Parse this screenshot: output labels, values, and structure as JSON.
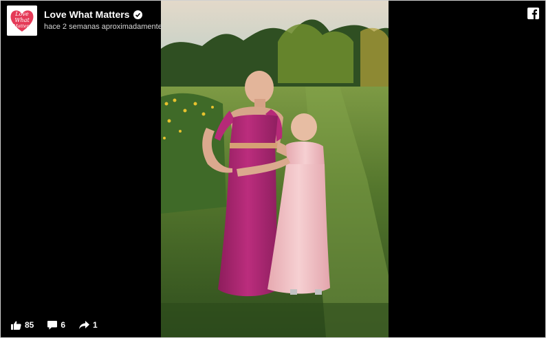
{
  "post": {
    "page_name": "Love What Matters",
    "verified": true,
    "timestamp": "hace 2 semanas aproximadamente"
  },
  "logo": {
    "text_line1": "Love",
    "text_line2": "What",
    "text_line3": "Matters",
    "heart_color": "#e53a57"
  },
  "stats": {
    "likes": "85",
    "comments": "6",
    "shares": "1"
  },
  "icons": {
    "like": "thumbs-up-icon",
    "comment": "speech-bubble-icon",
    "share": "share-arrow-icon",
    "facebook": "facebook-logo-icon",
    "verified": "check-badge-icon"
  },
  "colors": {
    "player_bg": "#000000",
    "text": "#ffffff",
    "dress_mother": "#b62a78",
    "dress_child": "#f1c3c6"
  }
}
